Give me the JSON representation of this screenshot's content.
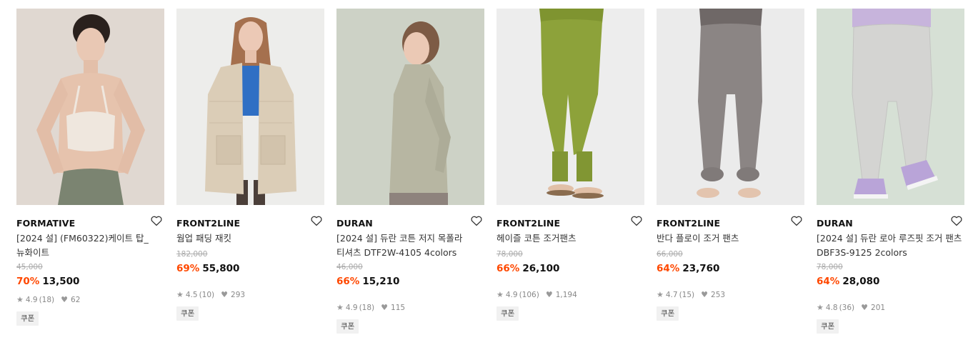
{
  "products": [
    {
      "brand": "FORMATIVE",
      "name_line1": "[2024 설] (FM60322)케이트 탑_",
      "name_line2": "뉴화이트",
      "original_price": "45,000",
      "discount": "70%",
      "price": "13,500",
      "rating": "4.9",
      "reviews": "(18)",
      "likes": "62",
      "coupon": "쿠폰",
      "bg": "#ded6cf"
    },
    {
      "brand": "FRONT2LINE",
      "name_line1": "웜업 패딩 재킷",
      "name_line2": "",
      "original_price": "182,000",
      "discount": "69%",
      "price": "55,800",
      "rating": "4.5",
      "reviews": "(10)",
      "likes": "293",
      "coupon": "쿠폰",
      "bg": "#ececea"
    },
    {
      "brand": "DURAN",
      "name_line1": "[2024 설] 듀란 코튼 저지 목폴라",
      "name_line2": "티셔츠 DTF2W-4105 4colors",
      "original_price": "46,000",
      "discount": "66%",
      "price": "15,210",
      "rating": "4.9",
      "reviews": "(18)",
      "likes": "115",
      "coupon": "쿠폰",
      "bg": "#cfd3c8"
    },
    {
      "brand": "FRONT2LINE",
      "name_line1": "헤이즐 코튼 조거팬츠",
      "name_line2": "",
      "original_price": "78,000",
      "discount": "66%",
      "price": "26,100",
      "rating": "4.9",
      "reviews": "(106)",
      "likes": "1,194",
      "coupon": "쿠폰",
      "bg": "#ececec"
    },
    {
      "brand": "FRONT2LINE",
      "name_line1": "반다 플로이 조거 팬츠",
      "name_line2": "",
      "original_price": "66,000",
      "discount": "64%",
      "price": "23,760",
      "rating": "4.7",
      "reviews": "(15)",
      "likes": "253",
      "coupon": "쿠폰",
      "bg": "#ebebeb"
    },
    {
      "brand": "DURAN",
      "name_line1": "[2024 설] 듀란 로아 루즈핏 조거 팬츠",
      "name_line2": "DBF3S-9125 2colors",
      "original_price": "78,000",
      "discount": "64%",
      "price": "28,080",
      "rating": "4.8",
      "reviews": "(36)",
      "likes": "201",
      "coupon": "쿠폰",
      "bg": "#d7e0d6"
    }
  ],
  "icons": {
    "wishlist": "heart-outline-icon",
    "rating": "star-icon",
    "likes": "heart-icon"
  },
  "colors": {
    "discount": "#ff4800",
    "text": "#111111",
    "muted": "#888888"
  }
}
